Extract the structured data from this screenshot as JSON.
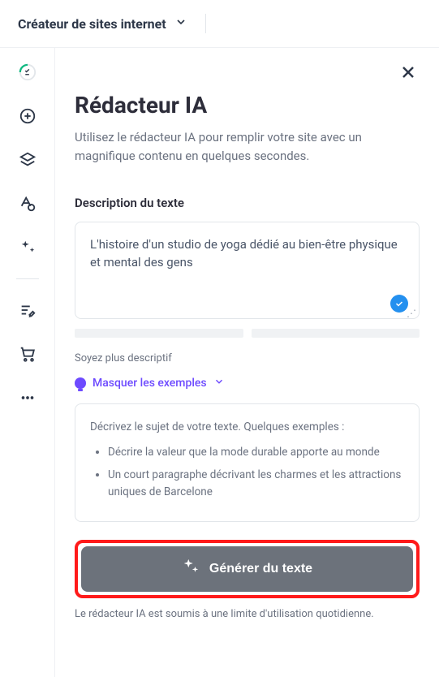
{
  "top": {
    "selector": "Créateur de sites internet"
  },
  "panel": {
    "title": "Rédacteur IA",
    "desc": "Utilisez le rédacteur IA pour remplir votre site avec un magnifique contenu en quelques secondes.",
    "section_label": "Description du texte",
    "input_value": "L'histoire d'un studio de yoga dédié au bien-être physique et mental des gens",
    "hint": "Soyez plus descriptif",
    "toggle_label": "Masquer les exemples",
    "examples_intro": "Décrivez le sujet de votre texte. Quelques exemples :",
    "example1": "Décrire la valeur que la mode durable apporte au monde",
    "example2": "Un court paragraphe décrivant les charmes et les attractions uniques de Barcelone",
    "generate_label": "Générer du texte",
    "footer": "Le rédacteur IA est soumis à une limite d'utilisation quotidienne."
  }
}
